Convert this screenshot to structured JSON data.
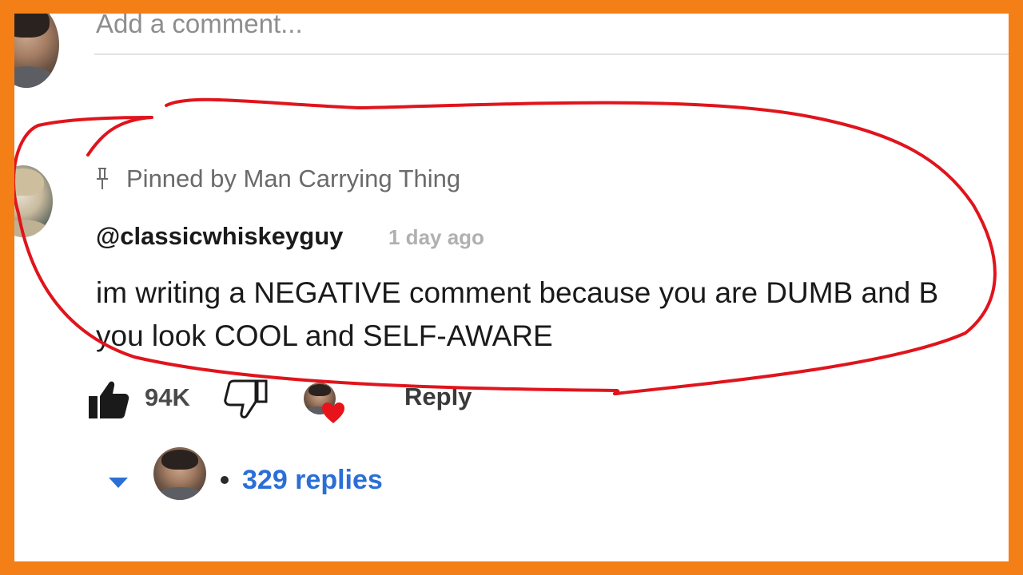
{
  "add_comment": {
    "placeholder": "Add a comment..."
  },
  "comment": {
    "pinned_label": "Pinned by Man Carrying Thing",
    "author": "@classicwhiskeyguy",
    "timestamp": "1 day ago",
    "text_line1": "im writing a NEGATIVE comment because you are DUMB and B",
    "text_line2": "you look COOL and SELF-AWARE",
    "like_count": "94K",
    "reply_label": "Reply",
    "replies_label": "329 replies"
  },
  "colors": {
    "border": "#f47f16",
    "annotation": "#e0141c",
    "link": "#2b6fd6",
    "heart": "#e8141b"
  },
  "icons": [
    "pin-icon",
    "thumbs-up-icon",
    "thumbs-down-icon",
    "heart-icon",
    "chevron-down-icon"
  ]
}
